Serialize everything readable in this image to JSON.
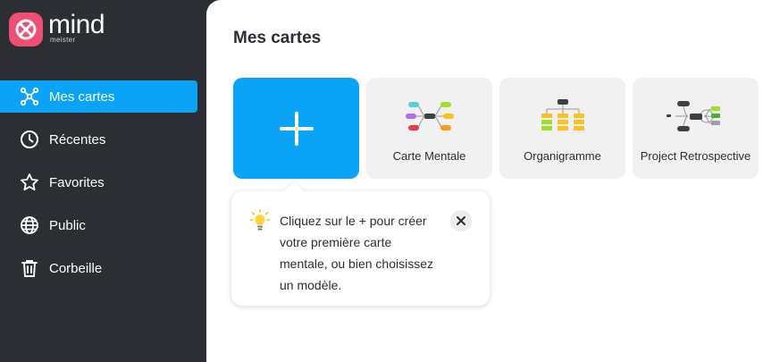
{
  "brand": {
    "name": "mind",
    "sub": "meister",
    "color": "#ef4f72"
  },
  "sidebar": {
    "items": [
      {
        "label": "Mes cartes",
        "icon": "mindmap-icon",
        "active": true
      },
      {
        "label": "Récentes",
        "icon": "clock-icon"
      },
      {
        "label": "Favorites",
        "icon": "star-icon"
      },
      {
        "label": "Public",
        "icon": "globe-icon"
      },
      {
        "label": "Corbeille",
        "icon": "trash-icon"
      }
    ]
  },
  "main": {
    "title": "Mes cartes",
    "cards": [
      {
        "label": "",
        "type": "new"
      },
      {
        "label": "Carte Mentale",
        "type": "template"
      },
      {
        "label": "Organigramme",
        "type": "template"
      },
      {
        "label": "Project Retrospective",
        "type": "template"
      }
    ],
    "tooltip": {
      "text": "Cliquez sur le + pour créer votre première carte mentale, ou bien choisissez un modèle."
    }
  },
  "colors": {
    "accent": "#0aa3f5",
    "sidebar": "#2b2f33"
  }
}
